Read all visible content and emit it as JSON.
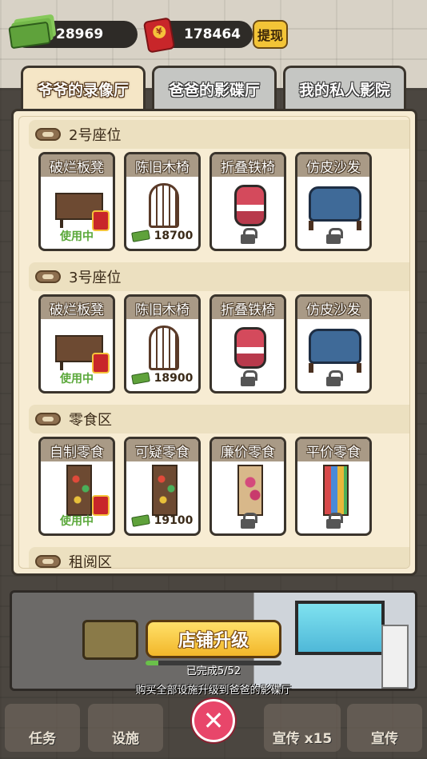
{
  "currency": {
    "cash": "28969",
    "red_packet": "178464",
    "withdraw_label": "提现"
  },
  "tabs": [
    {
      "label": "爷爷的录像厅",
      "active": true
    },
    {
      "label": "爸爸的影碟厅",
      "active": false
    },
    {
      "label": "我的私人影院",
      "active": false
    }
  ],
  "sections": [
    {
      "title": "2号座位",
      "items": [
        {
          "name": "破烂板凳",
          "status": "使用中",
          "art": "bench"
        },
        {
          "name": "陈旧木椅",
          "price": "18700",
          "art": "wood-chair"
        },
        {
          "name": "折叠铁椅",
          "locked": true,
          "art": "folding-chair"
        },
        {
          "name": "仿皮沙发",
          "locked": true,
          "art": "sofa"
        }
      ]
    },
    {
      "title": "3号座位",
      "items": [
        {
          "name": "破烂板凳",
          "status": "使用中",
          "art": "bench"
        },
        {
          "name": "陈旧木椅",
          "price": "18900",
          "art": "wood-chair"
        },
        {
          "name": "折叠铁椅",
          "locked": true,
          "art": "folding-chair"
        },
        {
          "name": "仿皮沙发",
          "locked": true,
          "art": "sofa"
        }
      ]
    },
    {
      "title": "零食区",
      "items": [
        {
          "name": "自制零食",
          "status": "使用中",
          "art": "snack-shelf"
        },
        {
          "name": "可疑零食",
          "price": "19100",
          "art": "snack-shelf"
        },
        {
          "name": "廉价零食",
          "locked": true,
          "art": "snack-shelf-pink"
        },
        {
          "name": "平价零食",
          "locked": true,
          "art": "snack-shelf-multi"
        }
      ]
    },
    {
      "title": "租阅区",
      "items": []
    }
  ],
  "upgrade": {
    "button_label": "店铺升级",
    "progress_text": "已完成5/52",
    "progress_done": 5,
    "progress_total": 52,
    "hint": "购买全部设施升级到爸爸的影碟厅"
  },
  "bottom_nav": [
    {
      "label": "任务"
    },
    {
      "label": "设施"
    },
    {
      "label": "宣传 x15"
    },
    {
      "label": "宣传"
    }
  ],
  "close_label": "✕",
  "colors": {
    "in_use": "#5aa83a",
    "accent_gold": "#f3c437",
    "close_pink": "#e8466a"
  }
}
